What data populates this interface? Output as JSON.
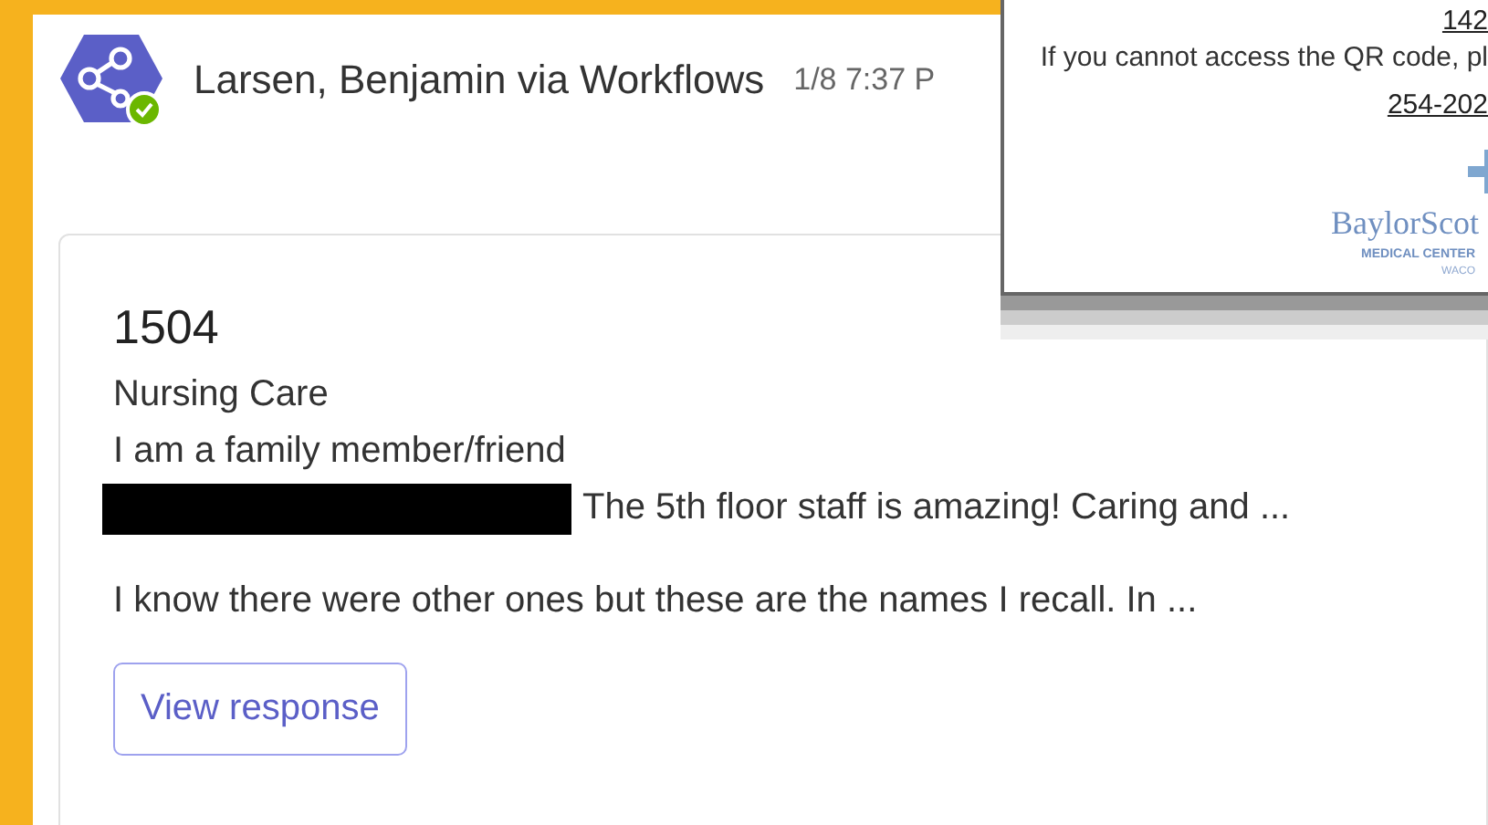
{
  "message": {
    "sender": "Larsen, Benjamin via Workflows",
    "timestamp": "1/8 7:37 P",
    "online": true
  },
  "card": {
    "title": "1504",
    "category": "Nursing Care",
    "relationship": "I am a family member/friend",
    "comment": {
      "redacted": true,
      "text": "The 5th floor staff is amazing! Caring and ..."
    },
    "detail": "I know there were other ones but these are the names I recall. In ...",
    "button": "View response"
  },
  "overlay": {
    "code_link": "142",
    "instruction": "If you cannot access the QR code, pl",
    "phone_link": "254-202",
    "logo": {
      "name": "BaylorScot",
      "subtitle": "MEDICAL CENTER",
      "city": "WACO"
    }
  }
}
